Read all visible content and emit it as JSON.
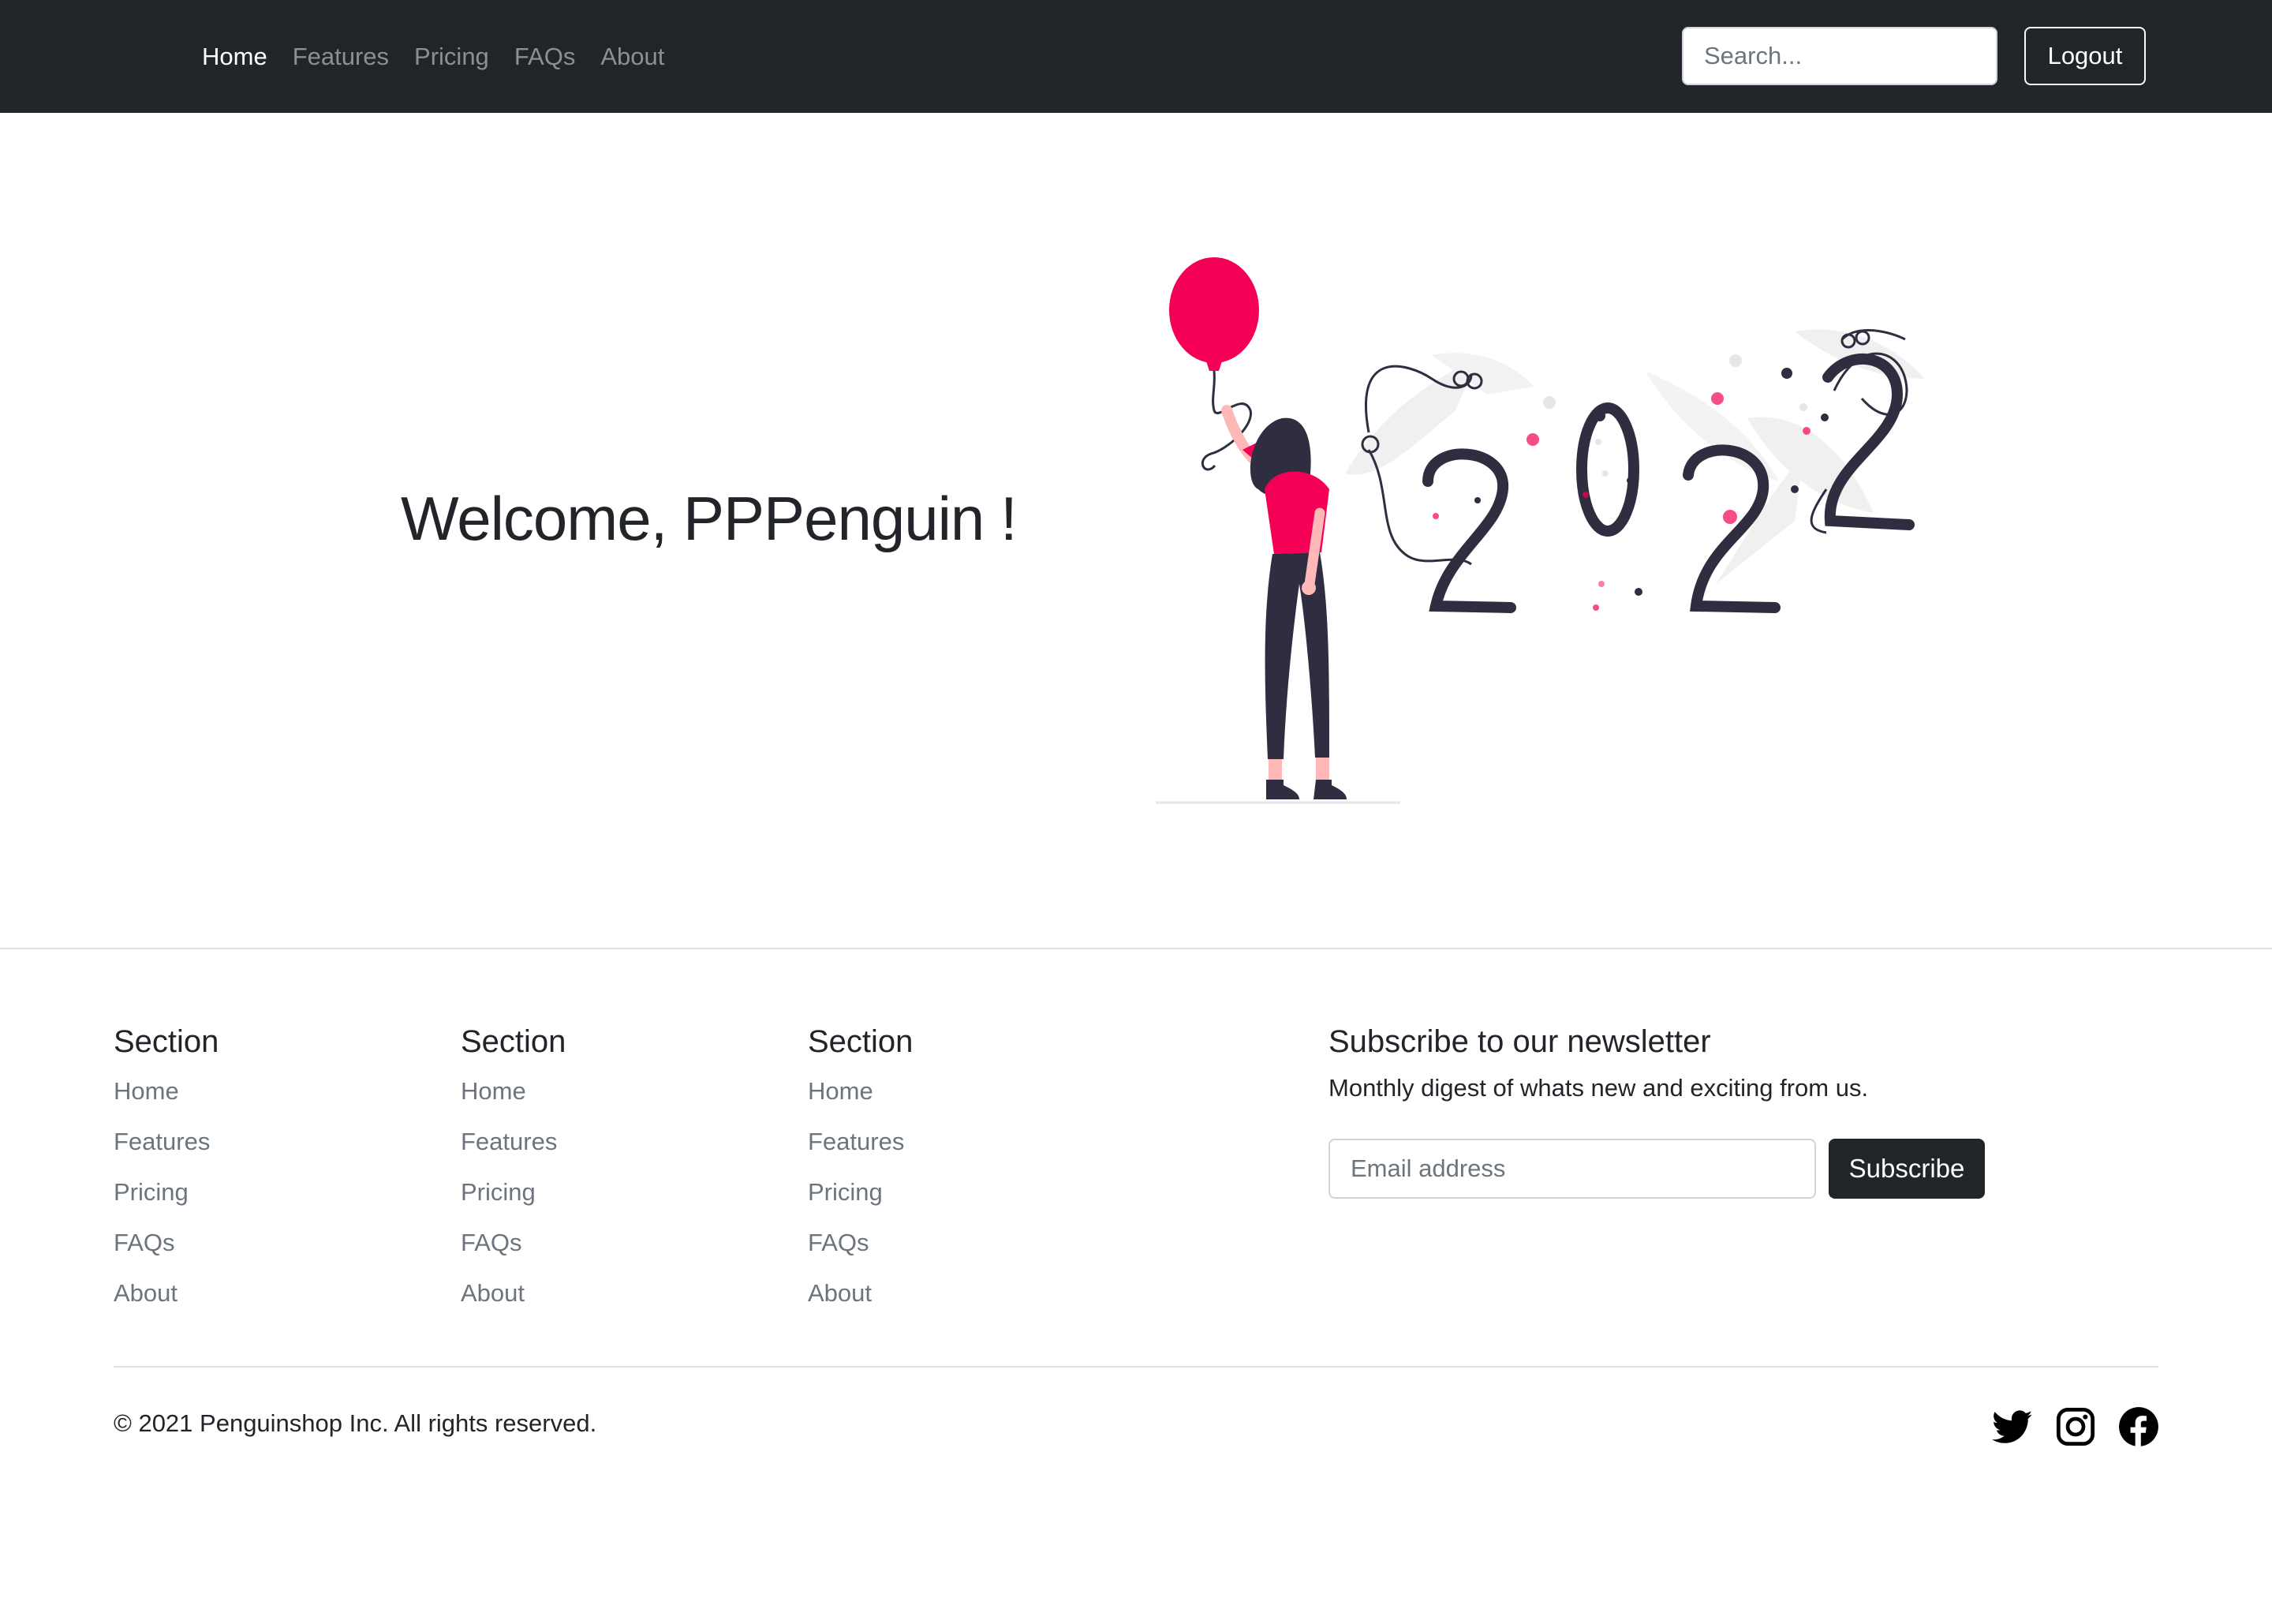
{
  "navbar": {
    "links": [
      "Home",
      "Features",
      "Pricing",
      "FAQs",
      "About"
    ],
    "search_placeholder": "Search...",
    "logout_label": "Logout"
  },
  "hero": {
    "title": "Welcome, PPPenguin !",
    "illustration_year": "2022",
    "illustration_icon": "balloon-woman-2022-illustration"
  },
  "footer": {
    "sections": [
      {
        "heading": "Section",
        "links": [
          "Home",
          "Features",
          "Pricing",
          "FAQs",
          "About"
        ]
      },
      {
        "heading": "Section",
        "links": [
          "Home",
          "Features",
          "Pricing",
          "FAQs",
          "About"
        ]
      },
      {
        "heading": "Section",
        "links": [
          "Home",
          "Features",
          "Pricing",
          "FAQs",
          "About"
        ]
      }
    ],
    "newsletter": {
      "heading": "Subscribe to our newsletter",
      "description": "Monthly digest of whats new and exciting from us.",
      "email_placeholder": "Email address",
      "subscribe_label": "Subscribe"
    },
    "copyright": "© 2021 Penguinshop Inc. All rights reserved.",
    "social_icons": [
      "twitter-icon",
      "instagram-icon",
      "facebook-icon"
    ]
  },
  "colors": {
    "navbar_bg": "#212529",
    "accent_pink": "#f50057",
    "dark": "#2f2e41",
    "muted_text": "#6c757d"
  }
}
